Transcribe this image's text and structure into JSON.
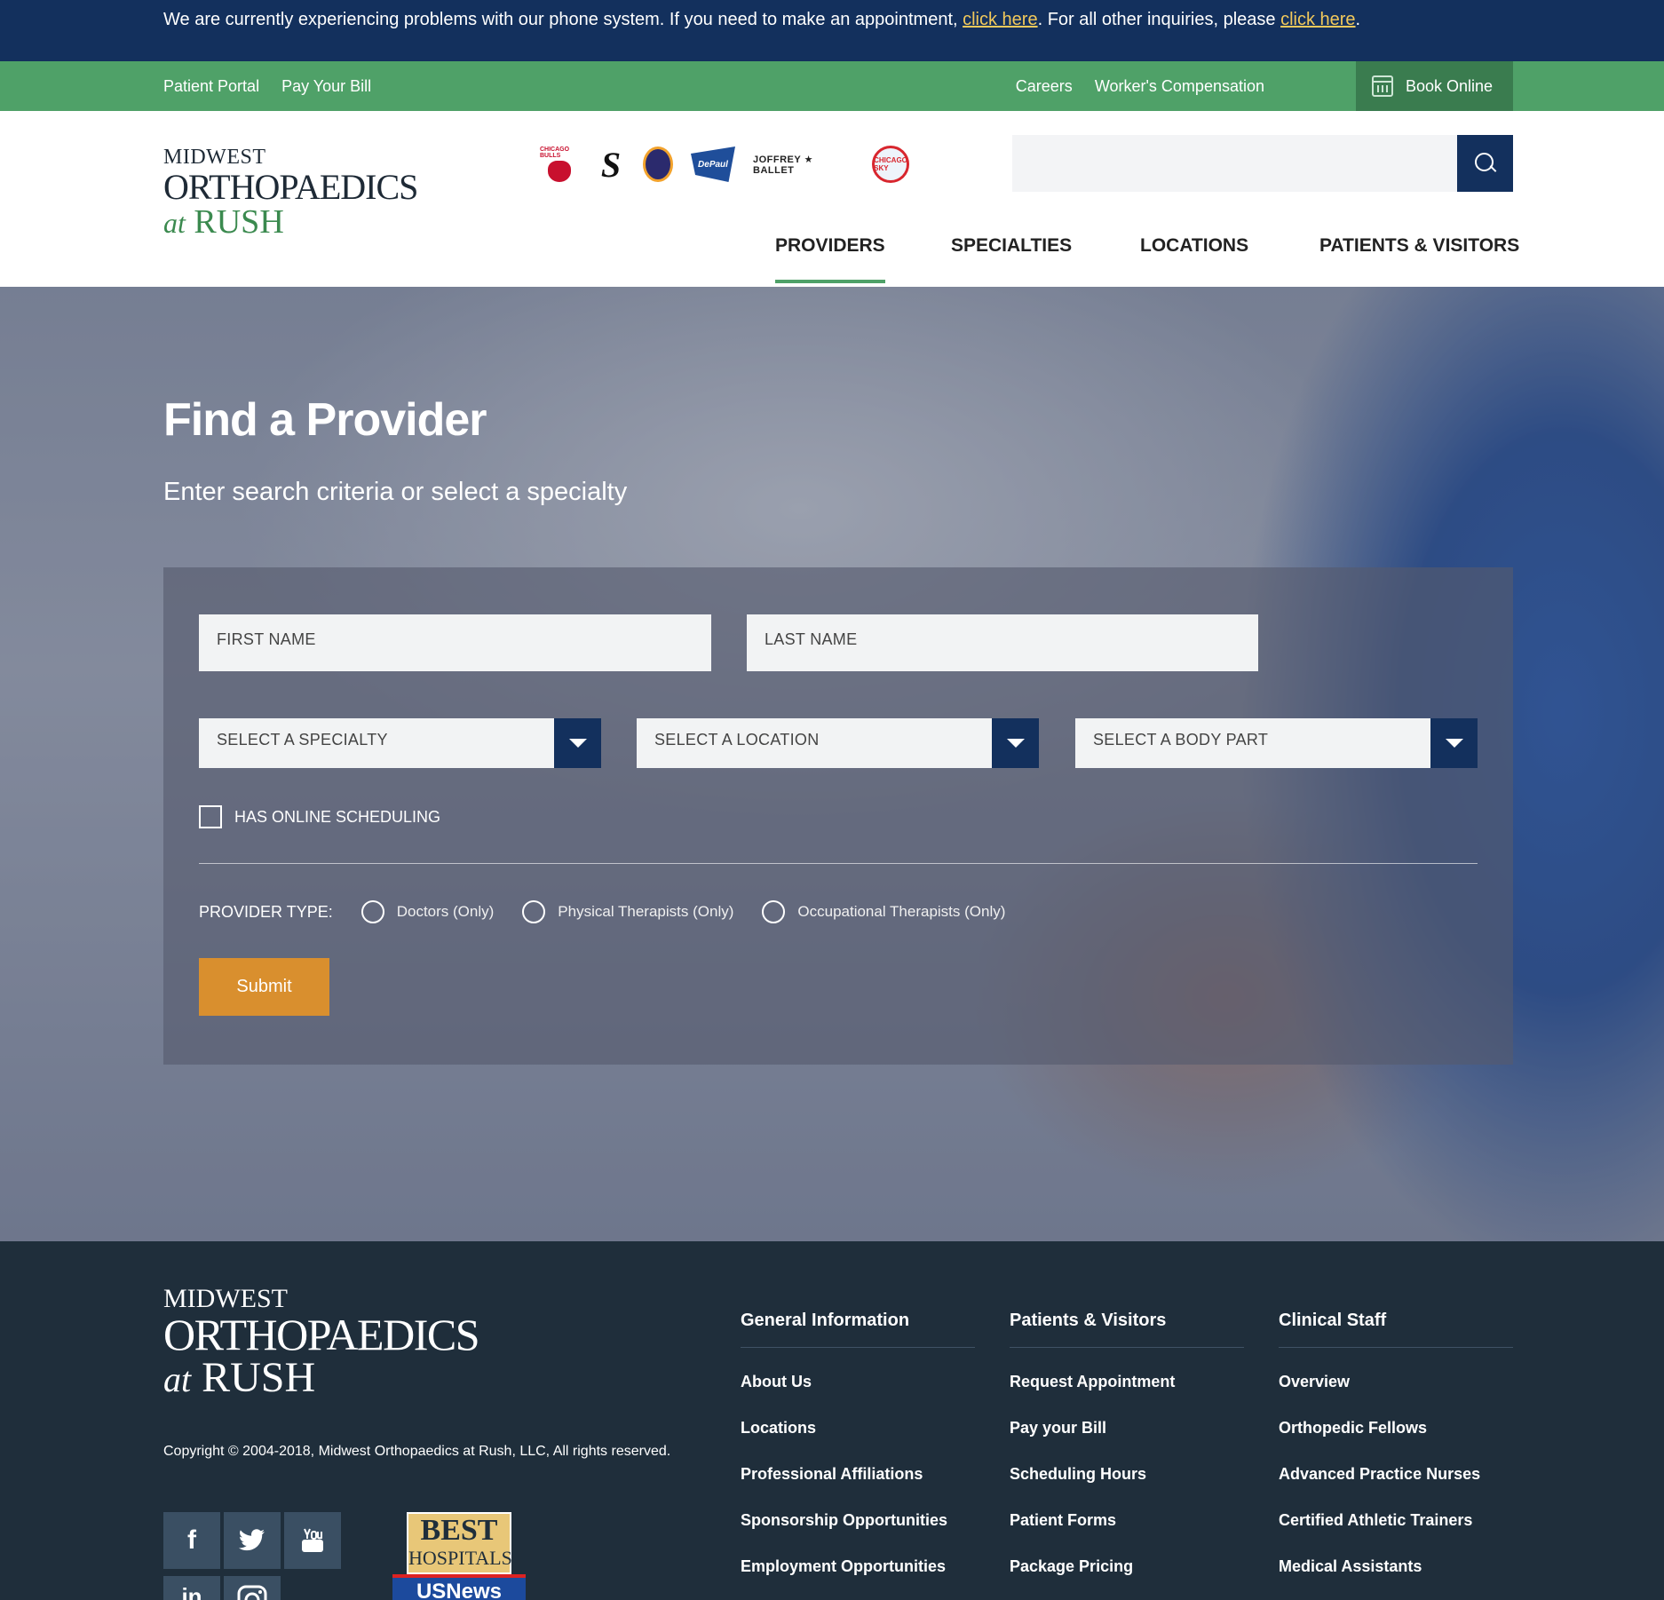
{
  "alert": {
    "text1": "We are currently experiencing problems with our phone system. If you need to make an appointment, ",
    "link1": "click here",
    "text2": ". For all other inquiries, please ",
    "link2": "click here",
    "text3": "."
  },
  "utility": {
    "left": [
      "Patient Portal",
      "Pay Your Bill"
    ],
    "right": [
      "Careers",
      "Worker's Compensation"
    ],
    "book": "Book Online"
  },
  "brand": {
    "line1": "MIDWEST",
    "line2": "ORTHOPAEDICS",
    "line3a": "at",
    "line3b": "RUSH"
  },
  "partners": {
    "bulls": "CHICAGO BULLS",
    "sox": "S",
    "depaul": "DePaul",
    "joffrey": "JOFFREY ★ BALLET",
    "sky": "CHICAGO SKY"
  },
  "nav": [
    "PROVIDERS",
    "SPECIALTIES",
    "LOCATIONS",
    "PATIENTS & VISITORS"
  ],
  "hero": {
    "title": "Find a Provider",
    "subtitle": "Enter search criteria or select a specialty"
  },
  "form": {
    "first_name": "FIRST NAME",
    "last_name": "LAST NAME",
    "specialty": "SELECT A SPECIALTY",
    "location": "SELECT A LOCATION",
    "body_part": "SELECT A BODY PART",
    "online_scheduling": "HAS ONLINE SCHEDULING",
    "provider_type_label": "PROVIDER TYPE:",
    "provider_types": [
      "Doctors (Only)",
      "Physical Therapists (Only)",
      "Occupational Therapists (Only)"
    ],
    "submit": "Submit"
  },
  "footer": {
    "copyright": "Copyright © 2004-2018, Midwest Orthopaedics at Rush, LLC, All rights reserved.",
    "social": {
      "facebook": "f",
      "linkedin": "in"
    },
    "badge": {
      "line1": "BEST",
      "line2": "HOSPITALS",
      "line3": "USNews"
    },
    "columns": [
      {
        "title": "General Information",
        "links": [
          "About Us",
          "Locations",
          "Professional Affiliations",
          "Sponsorship Opportunities",
          "Employment Opportunities"
        ]
      },
      {
        "title": "Patients & Visitors",
        "links": [
          "Request Appointment",
          "Pay your Bill",
          "Scheduling Hours",
          "Patient Forms",
          "Package Pricing"
        ]
      },
      {
        "title": "Clinical Staff",
        "links": [
          "Overview",
          "Orthopedic Fellows",
          "Advanced Practice Nurses",
          "Certified Athletic Trainers",
          "Medical Assistants"
        ]
      }
    ]
  },
  "colors": {
    "navy": "#13305d",
    "green": "#4fa168",
    "orange": "#d98f2e",
    "footer": "#1f2e3b"
  }
}
